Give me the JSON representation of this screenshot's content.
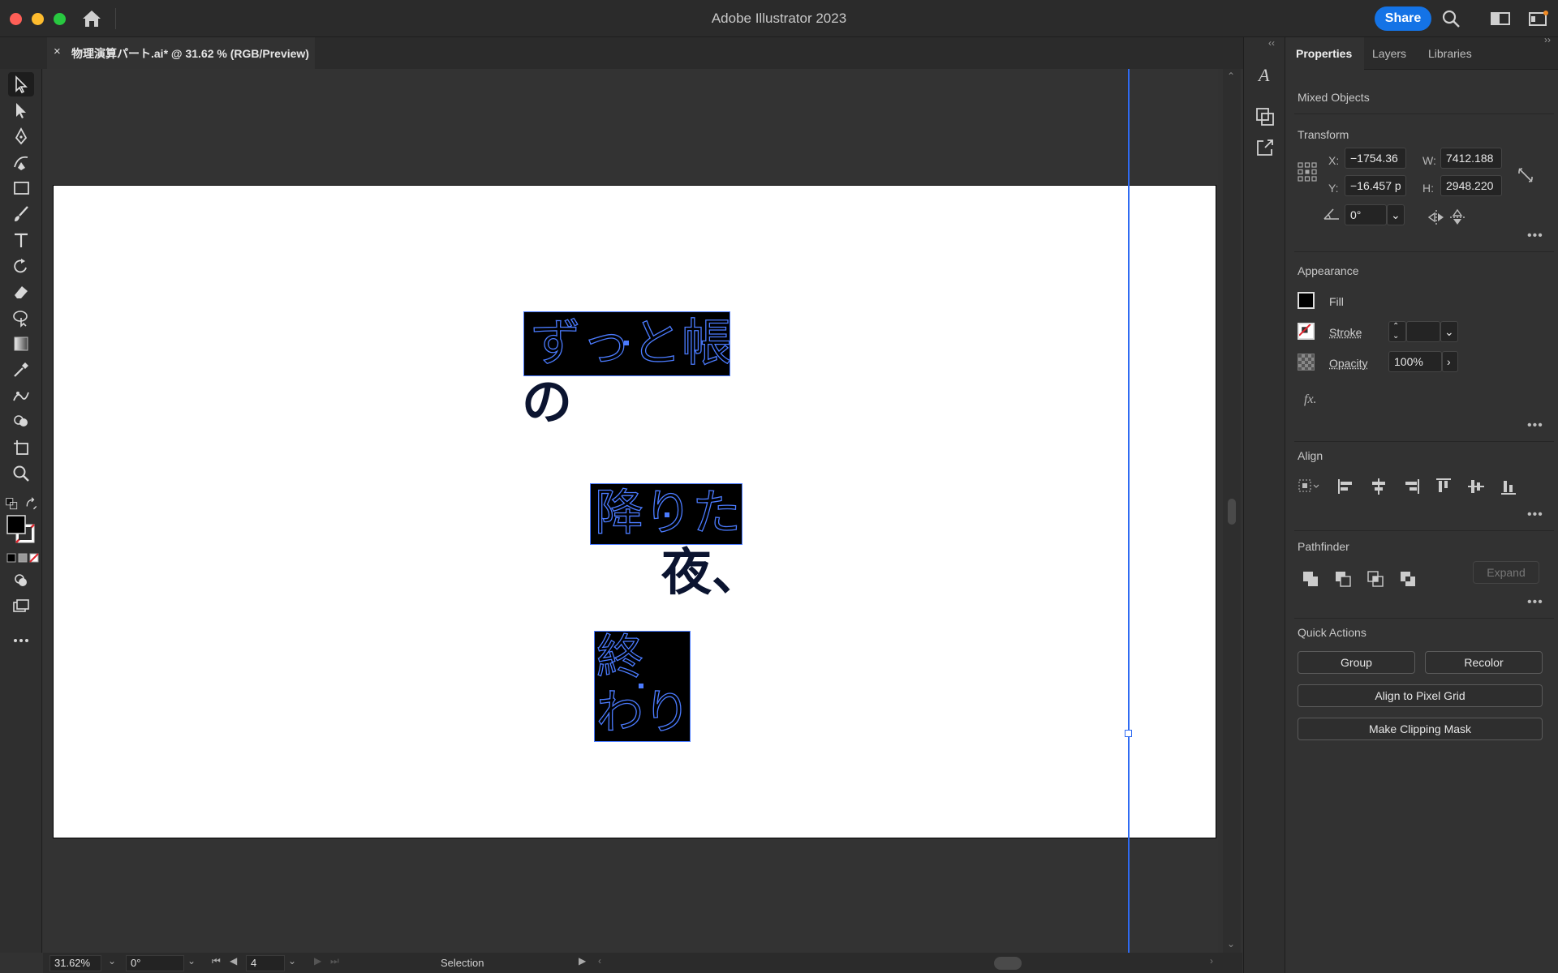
{
  "titlebar": {
    "app_title": "Adobe Illustrator 2023",
    "share_label": "Share"
  },
  "document_tab": {
    "close_glyph": "×",
    "label": "物理演算パート.ai* @ 31.62 % (RGB/Preview)"
  },
  "canvas": {
    "artboard_bg": "#ffffff",
    "guide_color": "#2f6bf2",
    "selection_color": "#4b7bff",
    "text_groups": {
      "g1_line1": "ずっと帳",
      "g1_line2": "の",
      "g2_line1": "降りた",
      "g2_line2": "夜、",
      "g3_line1": "終",
      "g3_line2": "わり"
    }
  },
  "statusbar": {
    "zoom": "31.62%",
    "rotation": "0°",
    "artboard_number": "4",
    "tool_status": "Selection"
  },
  "panel": {
    "tabs": [
      "Properties",
      "Layers",
      "Libraries"
    ],
    "selection_type": "Mixed Objects",
    "transform": {
      "title": "Transform",
      "x_label": "X:",
      "x_value": "−1754.36",
      "y_label": "Y:",
      "y_value": "−16.457 p",
      "w_label": "W:",
      "w_value": "7412.188",
      "h_label": "H:",
      "h_value": "2948.220",
      "rotate_value": "0°"
    },
    "appearance": {
      "title": "Appearance",
      "fill_label": "Fill",
      "stroke_label": "Stroke",
      "opacity_label": "Opacity",
      "opacity_value": "100%",
      "fx_label": "fx."
    },
    "align": {
      "title": "Align"
    },
    "pathfinder": {
      "title": "Pathfinder",
      "expand_label": "Expand"
    },
    "quick_actions": {
      "title": "Quick Actions",
      "group_label": "Group",
      "recolor_label": "Recolor",
      "pixel_grid_label": "Align to Pixel Grid",
      "clipping_mask_label": "Make Clipping Mask"
    }
  },
  "colors": {
    "accent": "#1473e6",
    "panel_bg": "#323232",
    "canvas_bg": "#333333"
  }
}
